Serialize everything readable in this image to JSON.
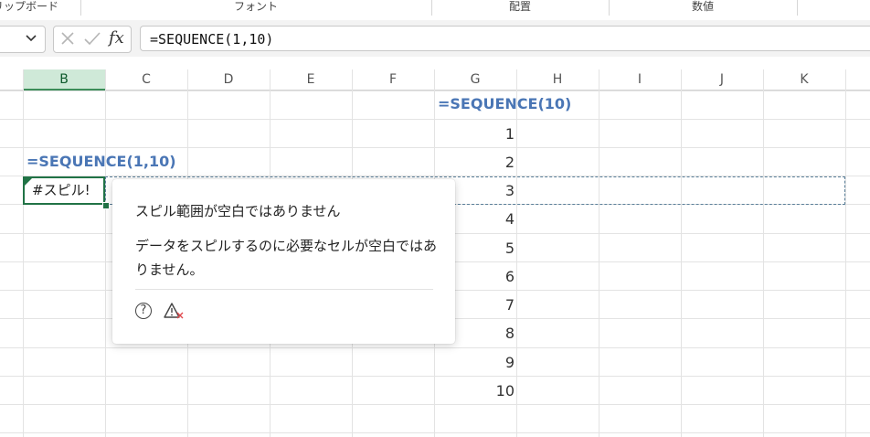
{
  "ribbon": {
    "groups": [
      {
        "label": "リップボード"
      },
      {
        "label": "フォント"
      },
      {
        "label": "配置"
      },
      {
        "label": "数値"
      }
    ]
  },
  "formula_bar": {
    "name_box": "",
    "formula": "=SEQUENCE(1,10)",
    "fx_label": "fx"
  },
  "grid": {
    "columns": [
      "B",
      "C",
      "D",
      "E",
      "F",
      "G",
      "H",
      "I",
      "J",
      "K"
    ],
    "selected_column": "B",
    "sequence_label_column": "=SEQUENCE(10)",
    "sequence_label_row": "=SEQUENCE(1,10)",
    "sequence_values": [
      "1",
      "2",
      "3",
      "4",
      "5",
      "6",
      "7",
      "8",
      "9",
      "10"
    ],
    "error_cell_text": "#スピル!"
  },
  "tooltip": {
    "title": "スピル範囲が空白ではありません",
    "body": "データをスピルするのに必要なセルが空白ではありません。",
    "help_icon_glyph": "?",
    "icons": [
      "help-icon",
      "warning-error-icon"
    ]
  },
  "colors": {
    "accent_green": "#217346",
    "header_selected_bg": "#cfe9d8",
    "formula_blue": "#4a76b5",
    "error_red": "#e0474c"
  }
}
